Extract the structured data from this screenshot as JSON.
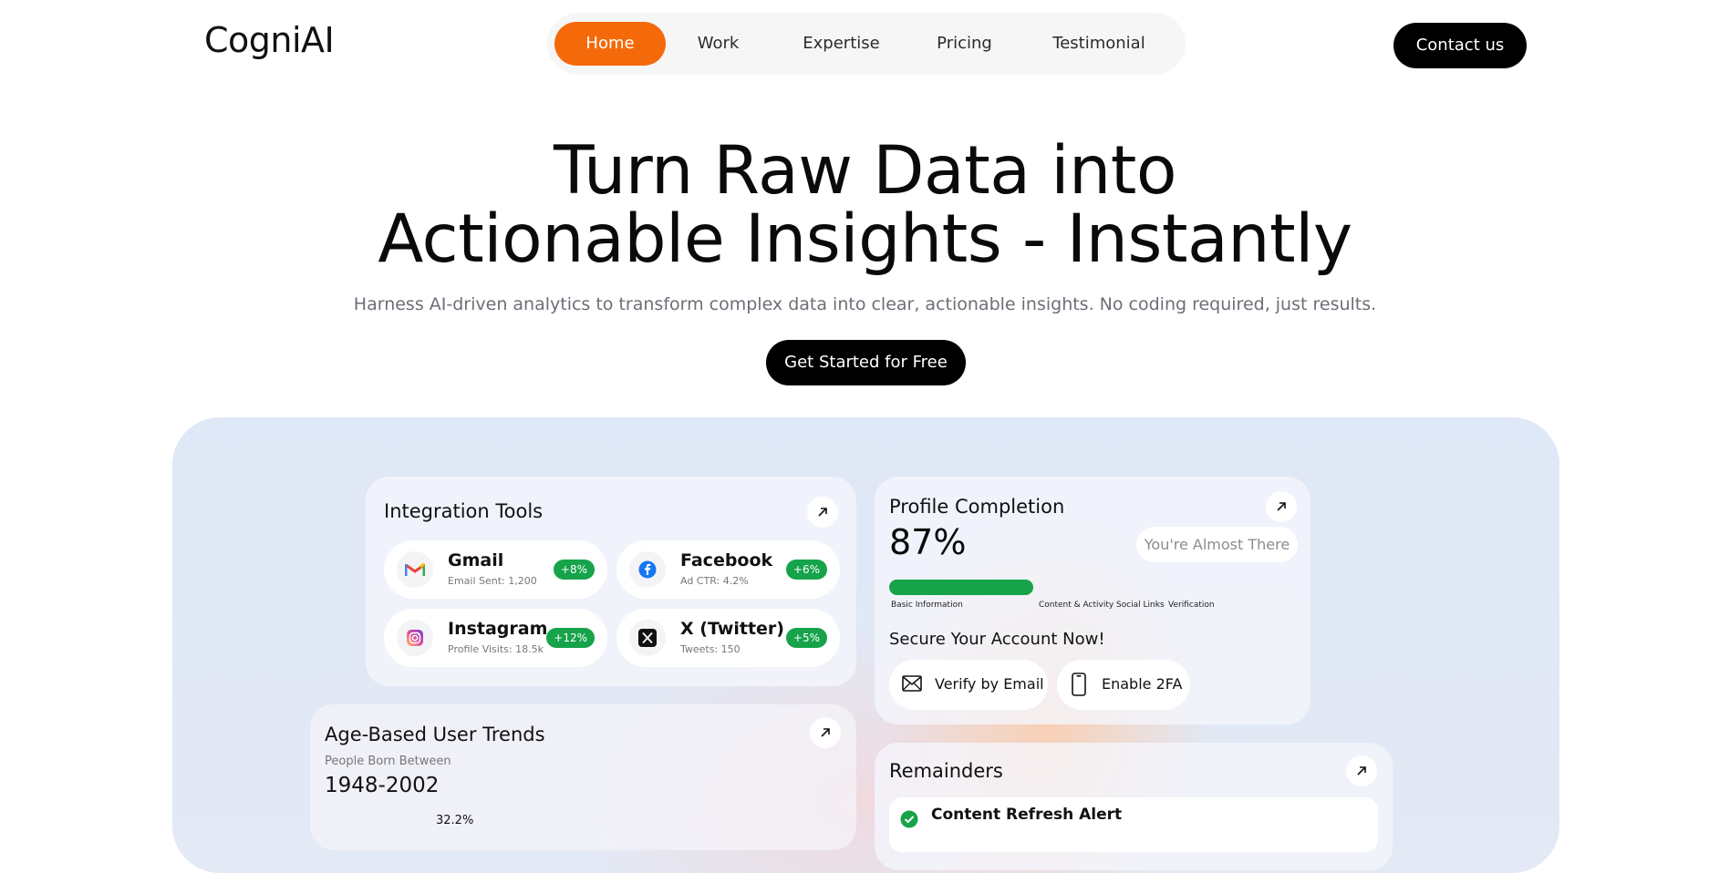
{
  "brand": {
    "logo": "CogniAI"
  },
  "nav": {
    "items": [
      {
        "label": "Home",
        "active": true
      },
      {
        "label": "Work"
      },
      {
        "label": "Expertise"
      },
      {
        "label": "Pricing"
      },
      {
        "label": "Testimonial"
      }
    ],
    "contact_label": "Contact us"
  },
  "hero": {
    "title_line1": "Turn Raw Data into",
    "title_line2": "Actionable Insights - Instantly",
    "subtitle": "Harness AI-driven analytics to transform complex data into clear, actionable insights. No coding required, just results.",
    "cta_label": "Get Started for Free"
  },
  "colors": {
    "accent": "#f46a0a",
    "success": "#16a34a",
    "dark": "#000000"
  },
  "integration": {
    "title": "Integration Tools",
    "tools": [
      {
        "name": "Gmail",
        "meta": "Email Sent: 1,200",
        "badge": "+8%",
        "icon": "gmail-icon"
      },
      {
        "name": "Facebook",
        "meta": "Ad CTR: 4.2%",
        "badge": "+6%",
        "icon": "facebook-icon"
      },
      {
        "name": "Instagram",
        "meta": "Profile Visits: 18.5k",
        "badge": "+12%",
        "icon": "instagram-icon"
      },
      {
        "name": "X (Twitter)",
        "meta": "Tweets: 150",
        "badge": "+5%",
        "icon": "x-icon"
      }
    ]
  },
  "profile": {
    "title": "Profile Completion",
    "percent_label": "87%",
    "status": "You're Almost There",
    "progress_fill": 0.33,
    "steps": [
      "Basic Information",
      "Content & Activity",
      "Social Links",
      "Verification"
    ],
    "secure_title": "Secure Your Account Now!",
    "verify_email_label": "Verify by Email",
    "enable_2fa_label": "Enable 2FA"
  },
  "age_trends": {
    "title": "Age-Based User Trends",
    "caption": "People Born Between",
    "range": "1948-2002",
    "first_value_label": "32.2%"
  },
  "reminders": {
    "title": "Remainders",
    "first_item": "Content Refresh Alert"
  }
}
